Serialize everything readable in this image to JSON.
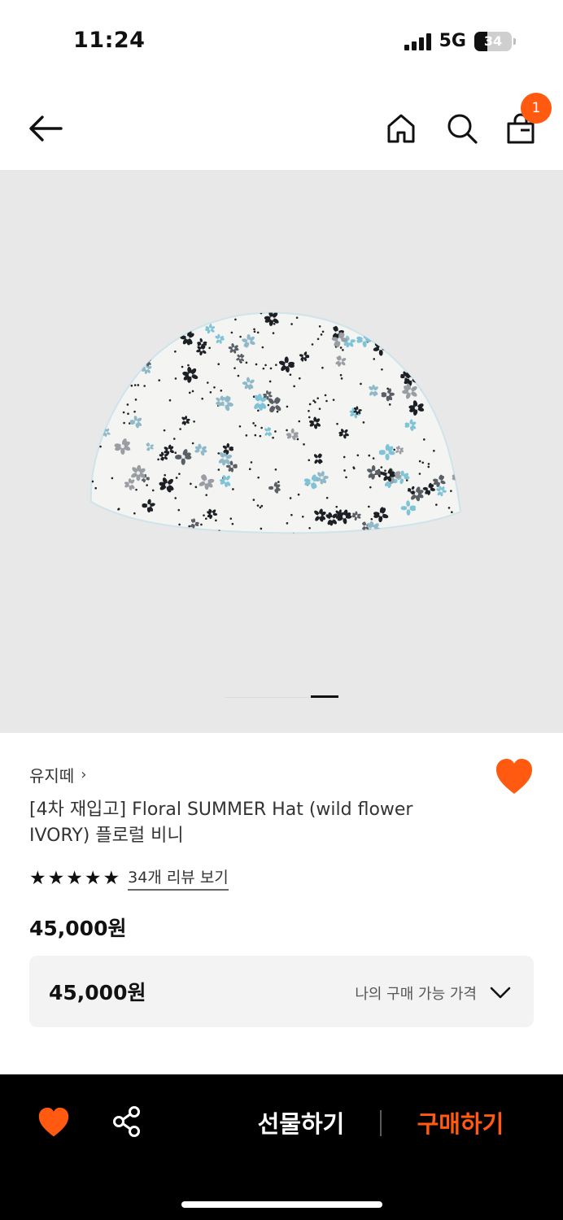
{
  "status_bar": {
    "time": "11:24",
    "network": "5G",
    "battery_percent": "34",
    "battery_level": 0.34
  },
  "nav": {
    "back_icon": "arrow-left-icon",
    "home_icon": "home-icon",
    "search_icon": "search-icon",
    "cart_icon": "shopping-bag-icon",
    "cart_count": "1"
  },
  "gallery": {
    "image_subject": "floral-beanie-hat",
    "current_page_fraction": 1.0
  },
  "product": {
    "brand": "유지떼",
    "brand_chevron": "›",
    "title": "[4차 재입고] Floral SUMMER Hat (wild flower IVORY) 플로럴 비니",
    "rating": 5,
    "stars": [
      "★",
      "★",
      "★",
      "★",
      "★"
    ],
    "review_link": "34개 리뷰 보기",
    "price": "45,000원",
    "liked": true
  },
  "price_box": {
    "amount": "45,000원",
    "hint": "나의 구매 가능 가격",
    "icon": "chevron-down-icon"
  },
  "bottom_bar": {
    "like_icon": "heart-icon",
    "share_icon": "share-icon",
    "gift_label": "선물하기",
    "buy_label": "구매하기"
  },
  "colors": {
    "accent": "#ff5a0f",
    "bottom_bar_bg": "#000000",
    "image_bg": "#e8e8e9",
    "price_box_bg": "#f3f3f4"
  }
}
